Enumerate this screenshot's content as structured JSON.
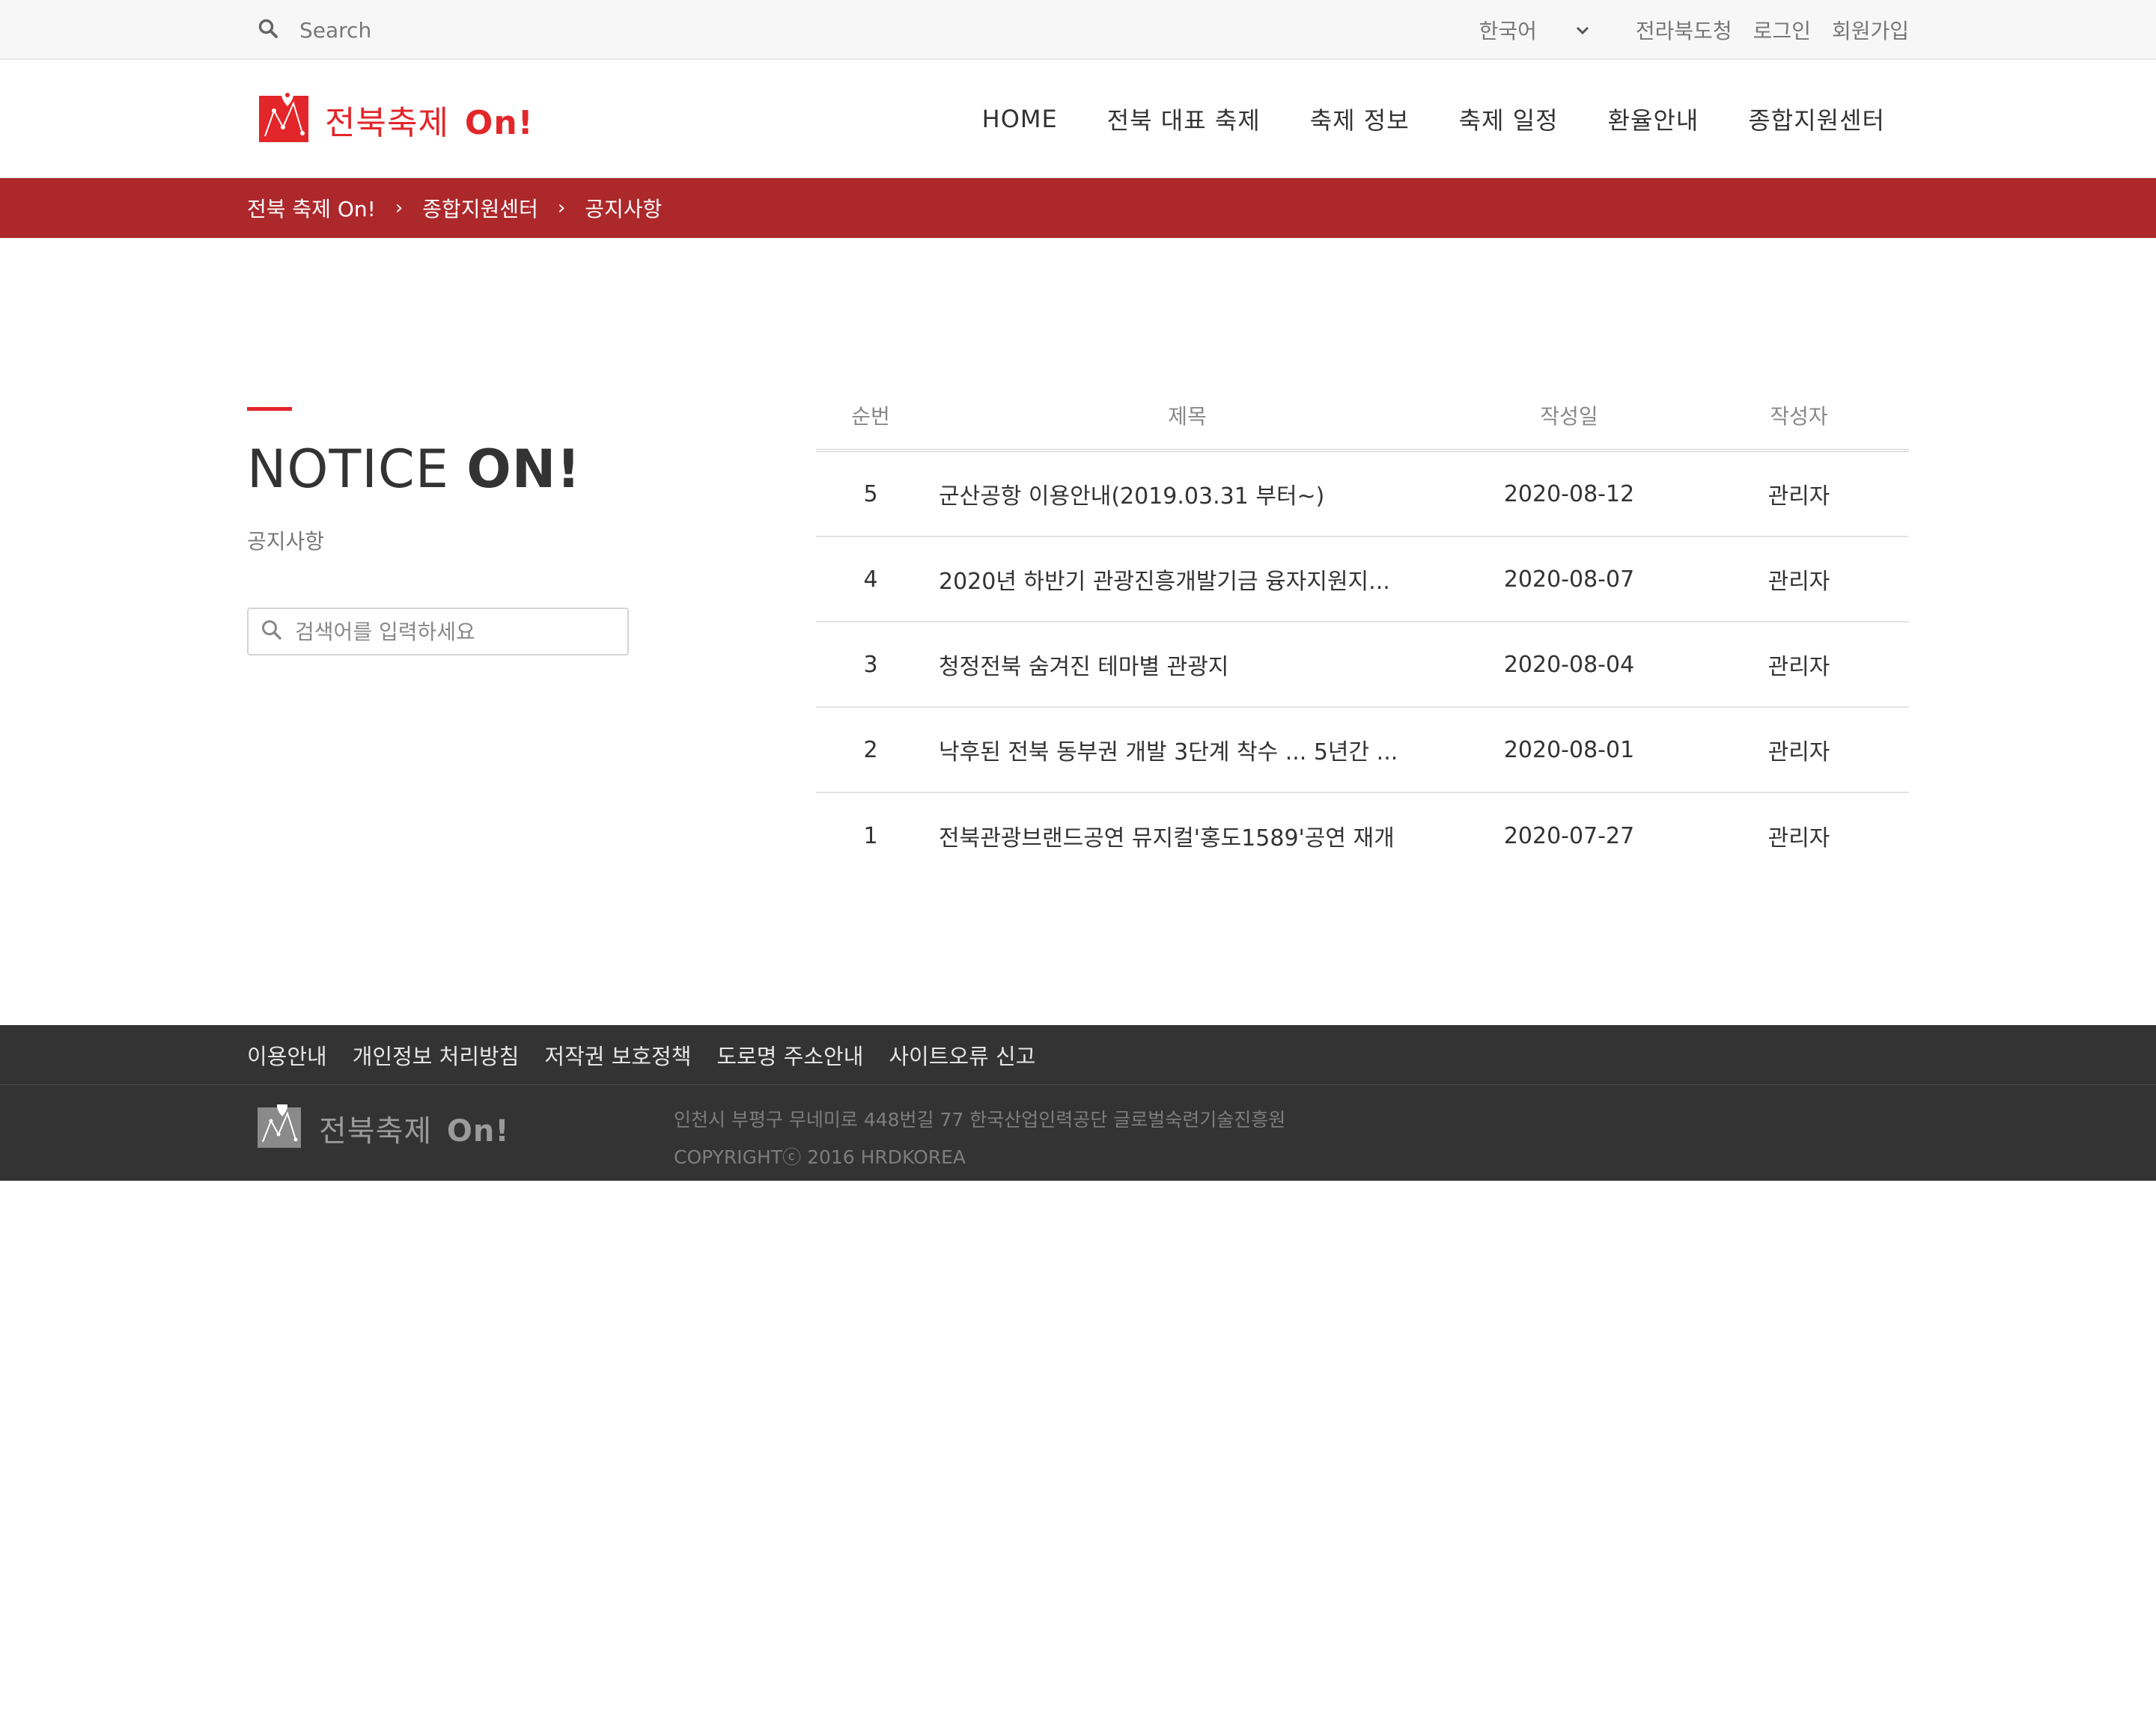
{
  "util": {
    "search_placeholder": "Search",
    "language": "한국어",
    "links": [
      "전라북도청",
      "로그인",
      "회원가입"
    ]
  },
  "header": {
    "logo_text": "전북축제",
    "logo_bold": "On!",
    "nav": [
      "HOME",
      "전북 대표 축제",
      "축제 정보",
      "축제 일정",
      "환율안내",
      "종합지원센터"
    ]
  },
  "breadcrumb": [
    "전북 축제 On!",
    "종합지원센터",
    "공지사항"
  ],
  "sidebar": {
    "title": "NOTICE",
    "title_bold": "ON!",
    "subtitle": "공지사항",
    "search_placeholder": "검색어를 입력하세요"
  },
  "board": {
    "headers": {
      "no": "순번",
      "title": "제목",
      "date": "작성일",
      "author": "작성자"
    },
    "rows": [
      {
        "no": "5",
        "title": "군산공항 이용안내(2019.03.31 부터~)",
        "date": "2020-08-12",
        "author": "관리자"
      },
      {
        "no": "4",
        "title": "2020년 하반기 관광진흥개발기금 융자지원지...",
        "date": "2020-08-07",
        "author": "관리자"
      },
      {
        "no": "3",
        "title": "청정전북 숨겨진 테마별 관광지",
        "date": "2020-08-04",
        "author": "관리자"
      },
      {
        "no": "2",
        "title": "낙후된 전북 동부권 개발 3단계 착수 ... 5년간 ...",
        "date": "2020-08-01",
        "author": "관리자"
      },
      {
        "no": "1",
        "title": "전북관광브랜드공연 뮤지컬'홍도1589'공연 재개",
        "date": "2020-07-27",
        "author": "관리자"
      }
    ]
  },
  "footer": {
    "links": [
      "이용안내",
      "개인정보 처리방침",
      "저작권 보호정책",
      "도로명 주소안내",
      "사이트오류 신고"
    ],
    "logo_text": "전북축제",
    "logo_bold": "On!",
    "address": "인천시 부평구 무네미로 448번길 77 한국산업인력공단 글로벌숙련기술진흥원",
    "copyright": "COPYRIGHTⓒ 2016 HRDKOREA"
  },
  "colors": {
    "brand_red": "#e3262a",
    "breadcrumb_bg": "#ad282b",
    "footer_bg": "#333333"
  }
}
